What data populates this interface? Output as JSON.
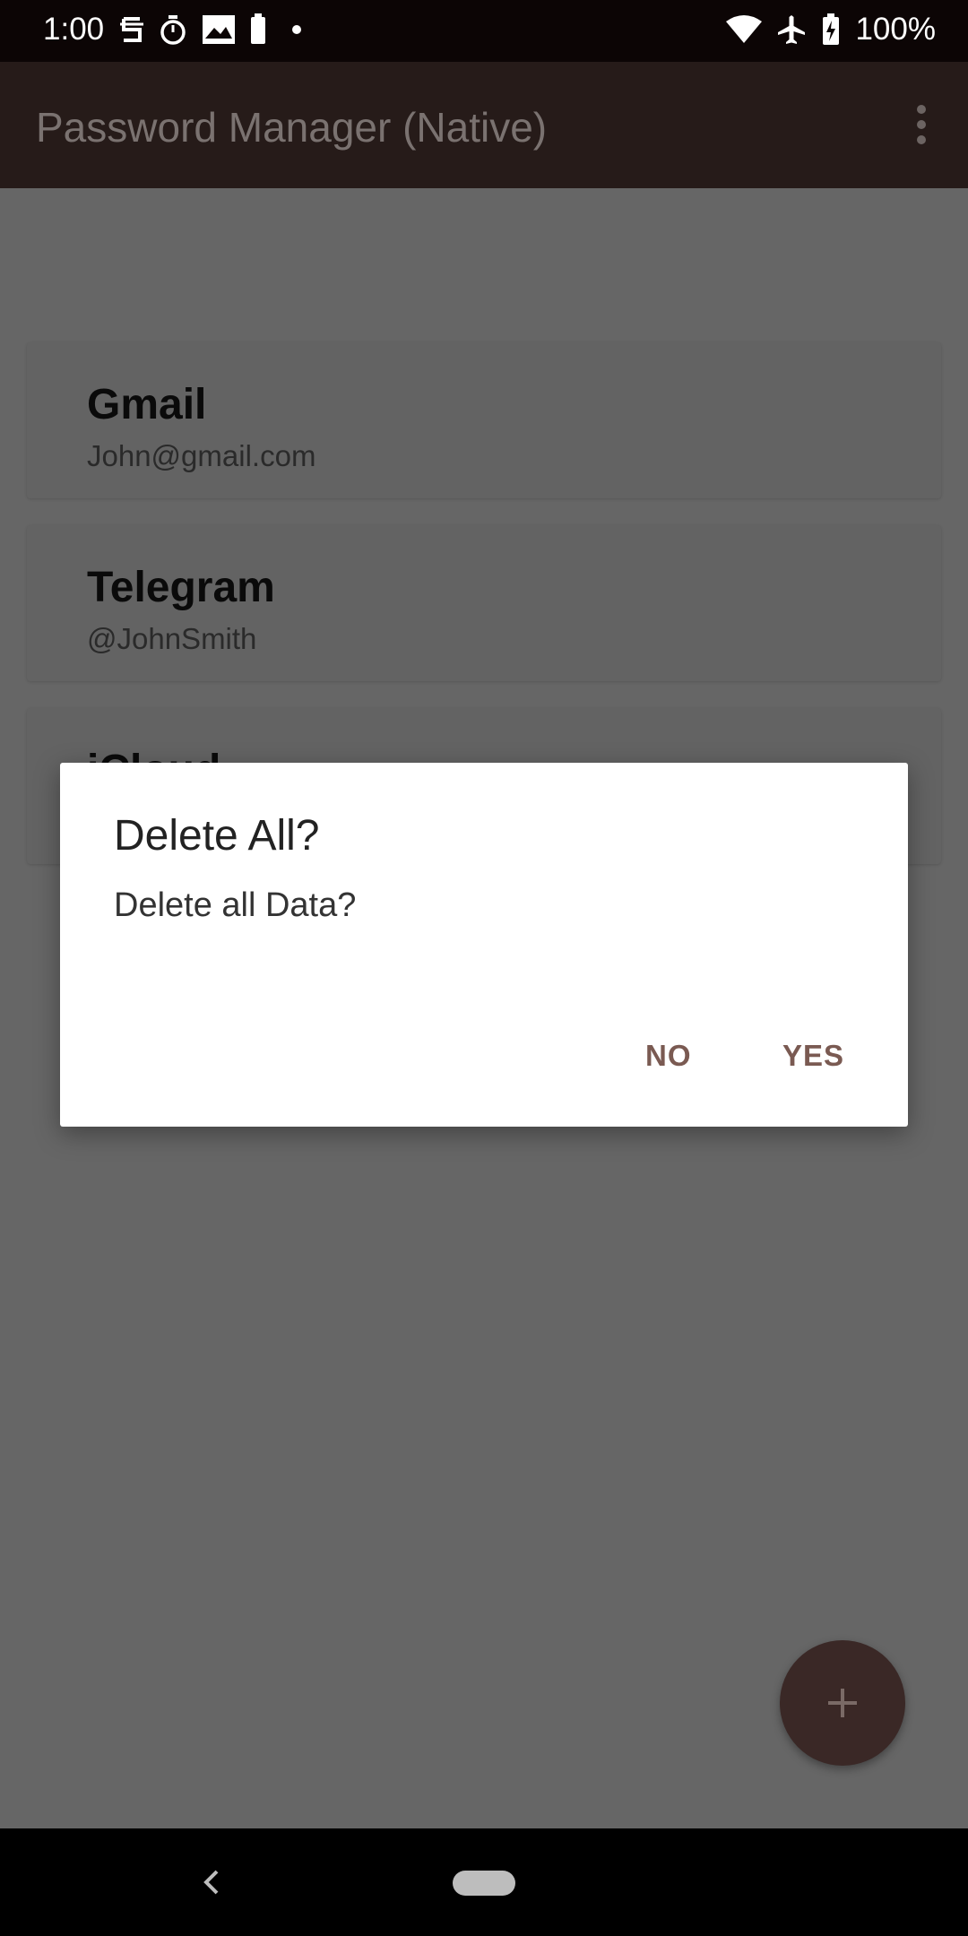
{
  "status_bar": {
    "time": "1:00",
    "battery_percent": "100%",
    "left_icons": [
      "notification-s-icon",
      "stopwatch-icon",
      "image-icon",
      "battery-small-icon",
      "dot-icon"
    ],
    "right_icons": [
      "wifi-icon",
      "airplane-icon",
      "battery-charging-icon"
    ]
  },
  "app_bar": {
    "title": "Password Manager (Native)",
    "menu_icon": "more-vert-icon"
  },
  "entries": [
    {
      "name": "Gmail",
      "account": "John@gmail.com"
    },
    {
      "name": "Telegram",
      "account": "@JohnSmith"
    },
    {
      "name": "iCloud",
      "account": ""
    }
  ],
  "dialog": {
    "title": "Delete All?",
    "message": "Delete all Data?",
    "no_label": "NO",
    "yes_label": "YES"
  },
  "fab": {
    "icon": "plus-icon"
  },
  "colors": {
    "app_bar_bg": "#261b19",
    "scrim_bg": "#666666",
    "accent_button_text": "#7a5a52",
    "fab_bg": "#3a2826"
  }
}
